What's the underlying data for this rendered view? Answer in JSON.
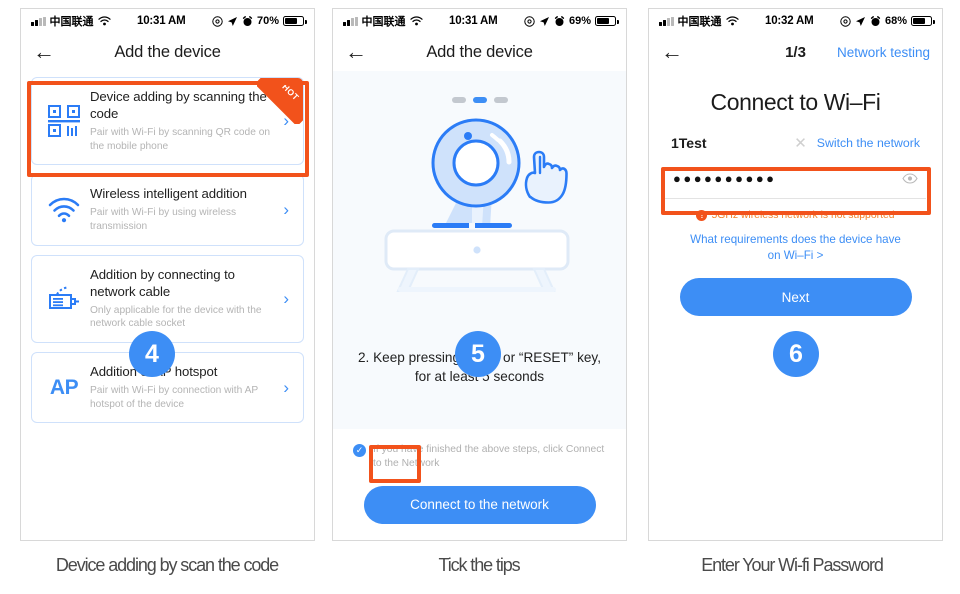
{
  "panels": [
    {
      "status": {
        "carrier": "中国联通",
        "time": "10:31 AM",
        "battery_pct": "70%"
      },
      "nav": {
        "back_icon": "arrow-left-icon",
        "title": "Add the device"
      },
      "cards": [
        {
          "icon": "qr-code-icon",
          "title": "Device adding by scanning the code",
          "subtitle": "Pair with Wi-Fi by scanning QR code on the mobile phone",
          "badge": "HOT",
          "chevron": "›"
        },
        {
          "icon": "wifi-icon",
          "title": "Wireless intelligent addition",
          "subtitle": "Pair with Wi-Fi by using wireless transmission",
          "chevron": "›"
        },
        {
          "icon": "ethernet-cable-icon",
          "title": "Addition by connecting to network cable",
          "subtitle": "Only applicable for the device with the network cable socket",
          "chevron": "›"
        },
        {
          "icon": "ap-text-icon",
          "icon_text": "AP",
          "title": "Addition of AP hotspot",
          "subtitle": "Pair with Wi-Fi by connection with AP hotspot of the device",
          "chevron": "›"
        }
      ],
      "step_badge": "4",
      "caption": "Device adding by scan the code"
    },
    {
      "status": {
        "carrier": "中国联通",
        "time": "10:31 AM",
        "battery_pct": "69%"
      },
      "nav": {
        "back_icon": "arrow-left-icon",
        "title": "Add the device"
      },
      "pager": {
        "count": 3,
        "active_index": 1
      },
      "illustration": "camera-on-stand-with-pointing-hand-icon",
      "instruction": "2. Keep pressing “SET” or “RESET” key, for at least 5 seconds",
      "checkbox": {
        "checked": true,
        "check_icon": "check-icon",
        "label": "If you have finished the above steps, click Connect to the Network"
      },
      "primary_button": "Connect to the network",
      "step_badge": "5",
      "caption": "Tick the tips"
    },
    {
      "status": {
        "carrier": "中国联通",
        "time": "10:32 AM",
        "battery_pct": "68%"
      },
      "nav": {
        "back_icon": "arrow-left-icon",
        "fraction": "1/3",
        "right_action": "Network testing"
      },
      "title": "Connect to Wi–Fi",
      "ssid": {
        "name": "1Test",
        "clear_icon": "close-x-icon",
        "switch_label": "Switch the network"
      },
      "password": {
        "value": "●●●●●●●●●●",
        "reveal_icon": "eye-icon"
      },
      "warning": {
        "icon": "exclamation-circle-icon",
        "mark": "!",
        "text": "5GHz wireless network is not supported"
      },
      "help_link": "What requirements does the device have on Wi–Fi >",
      "primary_button": "Next",
      "step_badge": "6",
      "caption": "Enter Your Wi-fi Password"
    }
  ],
  "colors": {
    "accent_blue": "#3d8ef5",
    "highlight_orange": "#f2521b",
    "warning_orange": "#f2832b",
    "card_border": "#cfe1fb",
    "hero_background": "#f7fafd"
  }
}
